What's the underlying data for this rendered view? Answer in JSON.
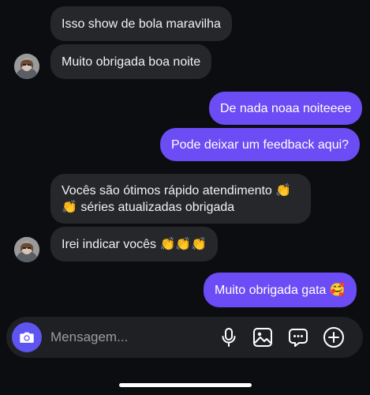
{
  "conversation": {
    "messages": [
      {
        "direction": "in",
        "text": "Isso show de bola maravilha"
      },
      {
        "direction": "in",
        "text": "Muito obrigada boa noite"
      },
      {
        "direction": "out",
        "text": "De nada noaa noiteeee"
      },
      {
        "direction": "out",
        "text": "Pode deixar um feedback aqui?"
      },
      {
        "direction": "in",
        "line1": "Vocês são ótimos rápido atendimento 👏",
        "line2": "👏 séries atualizadas obrigada"
      },
      {
        "direction": "in",
        "text": "Irei indicar vocês 👏👏👏"
      },
      {
        "direction": "out",
        "text": "Muito obrigada gata 🥰"
      }
    ],
    "avatar_icon": "contact-avatar"
  },
  "composer": {
    "placeholder": "Mensagem...",
    "camera_icon": "camera-icon",
    "mic_icon": "microphone-icon",
    "gallery_icon": "image-icon",
    "sticker_icon": "chat-bubble-icon",
    "plus_icon": "plus-circle-icon"
  },
  "colors": {
    "background": "#0b0d10",
    "incoming_bubble": "#26272b",
    "outgoing_bubble": "#6c4cf5",
    "camera_button": "#5e55f0"
  }
}
